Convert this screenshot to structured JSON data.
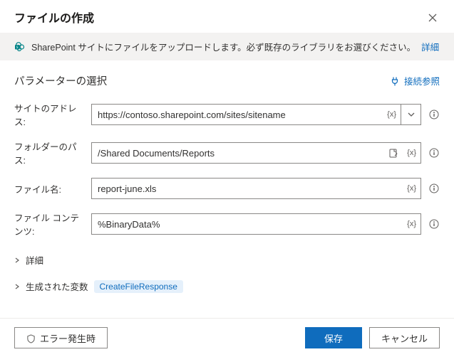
{
  "header": {
    "title": "ファイルの作成"
  },
  "info": {
    "text": "SharePoint サイトにファイルをアップロードします。必ず既存のライブラリをお選びください。",
    "link": "詳細"
  },
  "section": {
    "title": "パラメーターの選択",
    "connection_ref": "接続参照"
  },
  "fields": {
    "site": {
      "label": "サイトのアドレス:",
      "value": "https://contoso.sharepoint.com/sites/sitename",
      "fx": "{x}"
    },
    "folder": {
      "label": "フォルダーのパス:",
      "value": "/Shared Documents/Reports",
      "fx": "{x}"
    },
    "filename": {
      "label": "ファイル名:",
      "value": "report-june.xls",
      "fx": "{x}"
    },
    "content": {
      "label": "ファイル コンテンツ:",
      "value": "%BinaryData%",
      "fx": "{x}"
    }
  },
  "expanders": {
    "advanced": "詳細",
    "generated": "生成された変数",
    "generated_pill": "CreateFileResponse"
  },
  "footer": {
    "error": "エラー発生時",
    "save": "保存",
    "cancel": "キャンセル"
  }
}
